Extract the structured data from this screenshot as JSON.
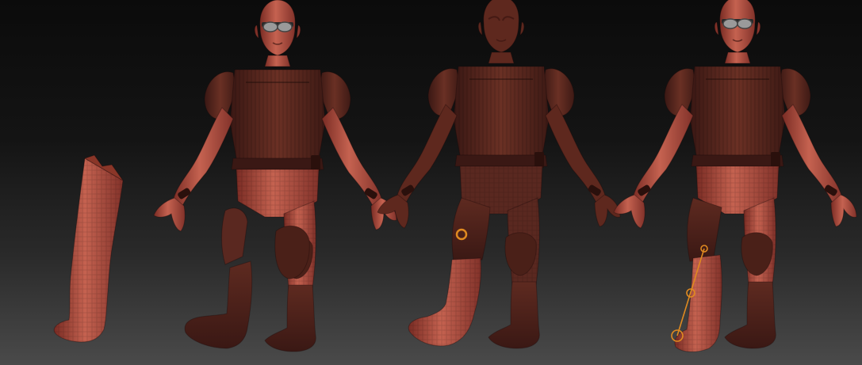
{
  "viewport": {
    "background_top": "#0b0b0b",
    "background_bottom": "#4a4a4a"
  },
  "palette": {
    "skin": "#b24a3c",
    "skin_light": "#c76452",
    "skin_shadow": "#6a2420",
    "armor": "#5a2820",
    "armor_light": "#6e3226",
    "armor_dark": "#3a1814",
    "goggles": "#9a9a9a",
    "gizmo": "#e08a20"
  },
  "figures": [
    {
      "name": "detached-leg-subtool"
    },
    {
      "name": "character-figure-exploded-leg"
    },
    {
      "name": "character-figure-leg-masked"
    },
    {
      "name": "character-figure-transpose"
    }
  ],
  "gizmos": [
    {
      "name": "masking-brush-cursor"
    },
    {
      "name": "transpose-line-gizmo"
    }
  ]
}
